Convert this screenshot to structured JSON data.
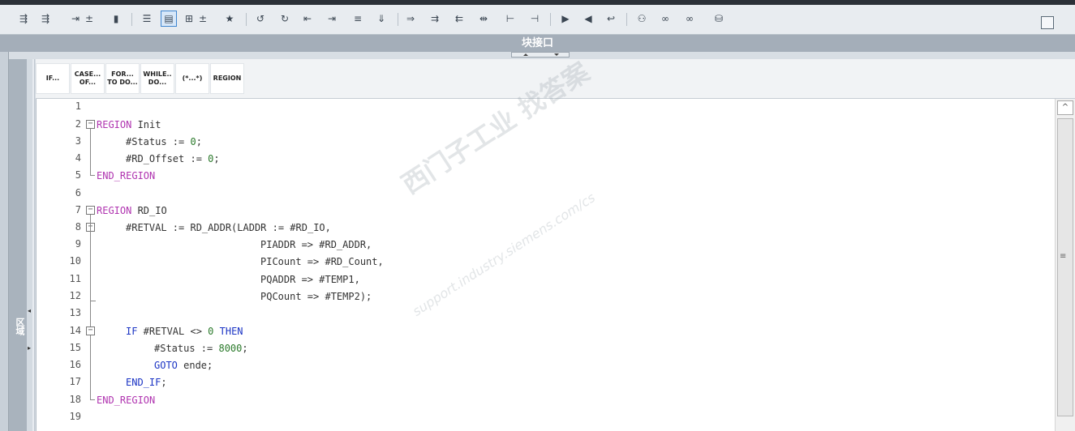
{
  "header": {
    "title": "块接口"
  },
  "sidebar": {
    "label": "区域"
  },
  "snippets": [
    {
      "l1": "IF...",
      "l2": ""
    },
    {
      "l1": "CASE...",
      "l2": "OF..."
    },
    {
      "l1": "FOR...",
      "l2": "TO DO..."
    },
    {
      "l1": "WHILE..",
      "l2": "DO..."
    },
    {
      "l1": "(*...*)",
      "l2": ""
    },
    {
      "l1": "REGION",
      "l2": ""
    }
  ],
  "code": {
    "line_numbers": [
      "1",
      "2",
      "3",
      "4",
      "5",
      "6",
      "7",
      "8",
      "9",
      "10",
      "11",
      "12",
      "13",
      "14",
      "15",
      "16",
      "17",
      "18",
      "19"
    ],
    "l2_kw": "REGION",
    "l2_rest": " Init",
    "l3_a": "#Status := ",
    "l3_num": "0",
    "l3_b": ";",
    "l4_a": "#RD_Offset := ",
    "l4_num": "0",
    "l4_b": ";",
    "l5_kw": "END_REGION",
    "l7_kw": "REGION",
    "l7_rest": " RD_IO",
    "l8": "#RETVAL := RD_ADDR(LADDR := #RD_IO,",
    "l9": "PIADDR => #RD_ADDR,",
    "l10": "PICount => #RD_Count,",
    "l11": "PQADDR => #TEMP1,",
    "l12": "PQCount => #TEMP2);",
    "l14_kw": "IF",
    "l14_mid": " #RETVAL <> ",
    "l14_num": "0",
    "l14_kw2": " THEN",
    "l15_a": "#Status := ",
    "l15_num": "8000",
    "l15_b": ";",
    "l16_kw": "GOTO",
    "l16_rest": " ende;",
    "l17_kw": "END_IF",
    "l17_rest": ";",
    "l18_kw": "END_REGION"
  },
  "watermark": {
    "cn": "西门子工业  找答案",
    "url": "support.industry.siemens.com/cs"
  },
  "colors": {
    "keyword_region": "#b034b0",
    "keyword_control": "#1b34c4",
    "number": "#2b7a2b"
  }
}
